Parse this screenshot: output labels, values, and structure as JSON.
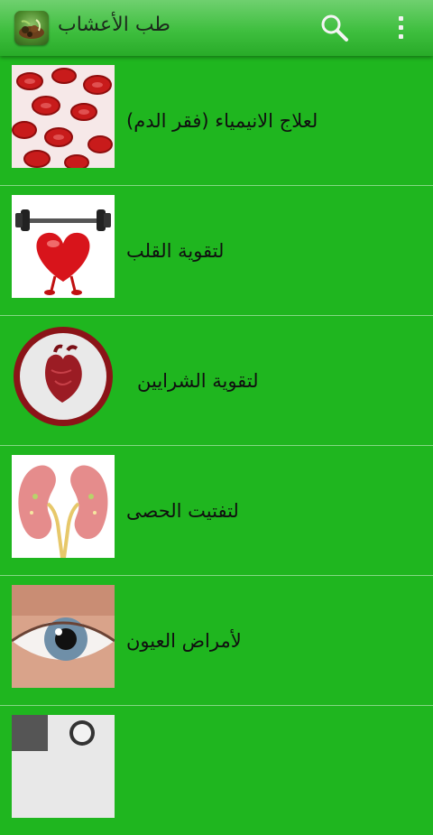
{
  "app": {
    "title": "طب الأعشاب",
    "icons": {
      "app": "herbs-app-icon",
      "search": "search-icon",
      "overflow": "overflow-menu-icon"
    }
  },
  "colors": {
    "background": "#1fb61f",
    "action_bar": "#3fbf3f",
    "divider": "#8fdc8f",
    "text": "#101010"
  },
  "items": [
    {
      "label": "لعلاج الانيمياء (فقر الدم)",
      "image": "red-blood-cells-image"
    },
    {
      "label": "لتقوية القلب",
      "image": "heart-lifting-dumbbell-image"
    },
    {
      "label": "لتقوية الشرايين",
      "image": "anatomical-heart-badge-image"
    },
    {
      "label": "لتفتيت الحصى",
      "image": "kidneys-image"
    },
    {
      "label": "لأمراض العيون",
      "image": "eye-image"
    }
  ]
}
